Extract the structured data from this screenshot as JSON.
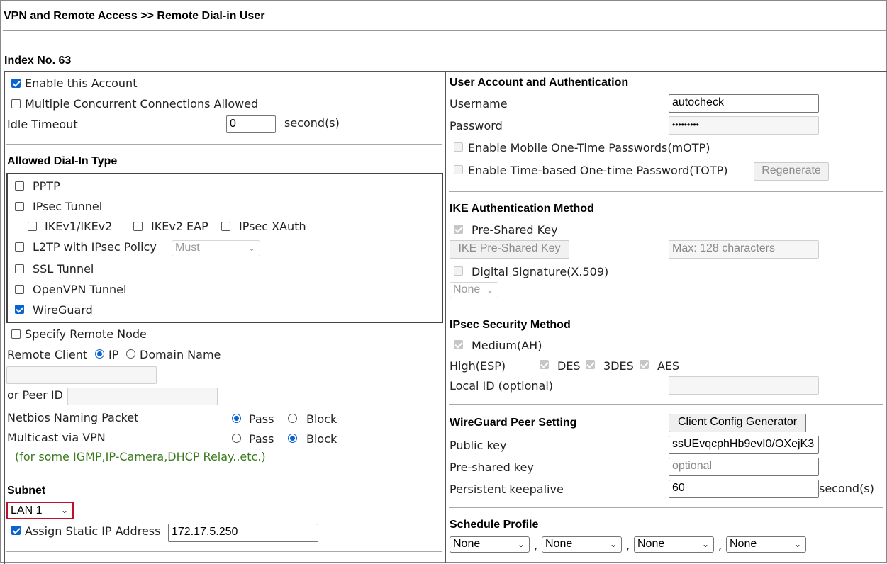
{
  "page": {
    "breadcrumb": "VPN and Remote Access >> Remote Dial-in User",
    "index_label": "Index No. 63"
  },
  "left": {
    "enable_account": "Enable this Account",
    "multi_conn": "Multiple Concurrent Connections Allowed",
    "idle_timeout_label": "Idle Timeout",
    "idle_timeout_value": "0",
    "idle_timeout_unit": "second(s)",
    "dialin_title": "Allowed Dial-In Type",
    "pptp": "PPTP",
    "ipsec_tunnel": "IPsec Tunnel",
    "ikev1": "IKEv1/IKEv2",
    "ikev2eap": "IKEv2 EAP",
    "ipsec_xauth": "IPsec XAuth",
    "l2tp": "L2TP with IPsec Policy",
    "l2tp_policy": "Must",
    "ssl": "SSL Tunnel",
    "openvpn": "OpenVPN Tunnel",
    "wireguard": "WireGuard",
    "specify_remote": "Specify Remote Node",
    "remote_client": "Remote Client",
    "ip": "IP",
    "domain_name": "Domain Name",
    "peer_id": "or Peer ID",
    "netbios": "Netbios Naming Packet",
    "multicast": "Multicast via VPN",
    "pass": "Pass",
    "block": "Block",
    "multicast_note": "(for some IGMP,IP-Camera,DHCP Relay..etc.)",
    "subnet_title": "Subnet",
    "subnet_value": "LAN 1",
    "assign_static": "Assign Static IP Address",
    "static_ip": "172.17.5.250"
  },
  "right": {
    "auth_title": "User Account and Authentication",
    "username_label": "Username",
    "username_value": "autocheck",
    "password_label": "Password",
    "password_value": "•••••••••",
    "motp": "Enable Mobile One-Time Passwords(mOTP)",
    "totp": "Enable Time-based One-time Password(TOTP)",
    "regenerate": "Regenerate",
    "ike_title": "IKE Authentication Method",
    "psk": "Pre-Shared Key",
    "ike_psk_button": "IKE Pre-Shared Key",
    "psk_placeholder": "Max: 128 characters",
    "digital_sig": "Digital Signature(X.509)",
    "digital_sig_select": "None",
    "ipsec_title": "IPsec Security Method",
    "medium": "Medium(AH)",
    "high": "High(ESP)",
    "des": "DES",
    "tdes": "3DES",
    "aes": "AES",
    "local_id": "Local ID (optional)",
    "wg_title": "WireGuard Peer Setting",
    "client_config": "Client Config Generator",
    "public_key_label": "Public key",
    "public_key_value": "ssUEvqcphHb9evI0/OXejK3",
    "preshared_label": "Pre-shared key",
    "preshared_placeholder": "optional",
    "keepalive_label": "Persistent keepalive",
    "keepalive_value": "60",
    "keepalive_unit": "second(s)",
    "schedule_title": "Schedule Profile",
    "schedules": [
      "None",
      "None",
      "None",
      "None"
    ],
    "comma": ","
  }
}
